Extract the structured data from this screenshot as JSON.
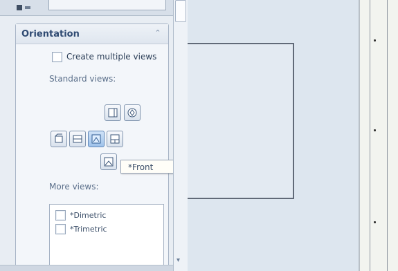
{
  "panel": {
    "section_title": "Orientation",
    "create_multiple_views": "Create multiple views",
    "standard_views_label": "Standard views:",
    "tooltip": "*Front",
    "more_views_label": "More views:",
    "more_views": [
      {
        "label": "*Dimetric"
      },
      {
        "label": "*Trimetric"
      }
    ]
  },
  "icons": {
    "collapse": "chevron-up-double",
    "scroll_down": "scroll-down-arrow"
  },
  "colors": {
    "panel_bg": "#e8edf3",
    "canvas_bg": "#dde6ef",
    "tooltip_bg": "#fffef8",
    "accent": "#2f4a72"
  }
}
